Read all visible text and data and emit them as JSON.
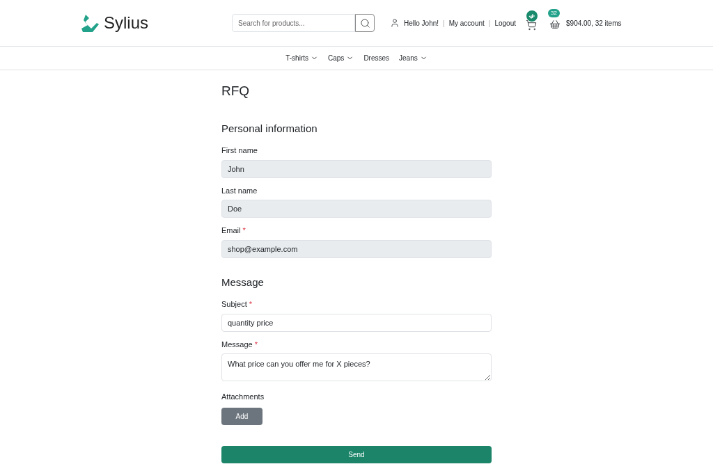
{
  "header": {
    "logo_text": "Sylius",
    "search": {
      "placeholder": "Search for products..."
    },
    "greeting": "Hello John!",
    "links": [
      {
        "separator": "|",
        "label": "My account"
      },
      {
        "separator": "|",
        "label": "Logout"
      }
    ],
    "cart": {
      "count": "32",
      "summary": "$904.00, 32 items"
    }
  },
  "nav": [
    {
      "label": "T-shirts",
      "dropdown": true
    },
    {
      "label": "Caps",
      "dropdown": true
    },
    {
      "label": "Dresses",
      "dropdown": false
    },
    {
      "label": "Jeans",
      "dropdown": true
    }
  ],
  "title": "RFQ",
  "sections": [
    {
      "heading": "Personal information",
      "fields": [
        {
          "label": "First name",
          "value": "John",
          "disabled": true,
          "kind": "input"
        },
        {
          "label": "Last name",
          "value": "Doe",
          "disabled": true,
          "kind": "input"
        },
        {
          "label": "Email",
          "required_mark": "*",
          "value": "shop@example.com",
          "disabled": true,
          "kind": "input"
        }
      ]
    },
    {
      "heading": "Message",
      "fields": [
        {
          "label": "Subject",
          "required_mark": "*",
          "value": "quantity price",
          "disabled": false,
          "kind": "input"
        },
        {
          "label": "Message",
          "required_mark": "*",
          "value": "What price can you offer me for X pieces?",
          "disabled": false,
          "kind": "textarea"
        }
      ]
    }
  ],
  "attachments": {
    "label": "Attachments",
    "button": "Add"
  },
  "submit": "Send"
}
